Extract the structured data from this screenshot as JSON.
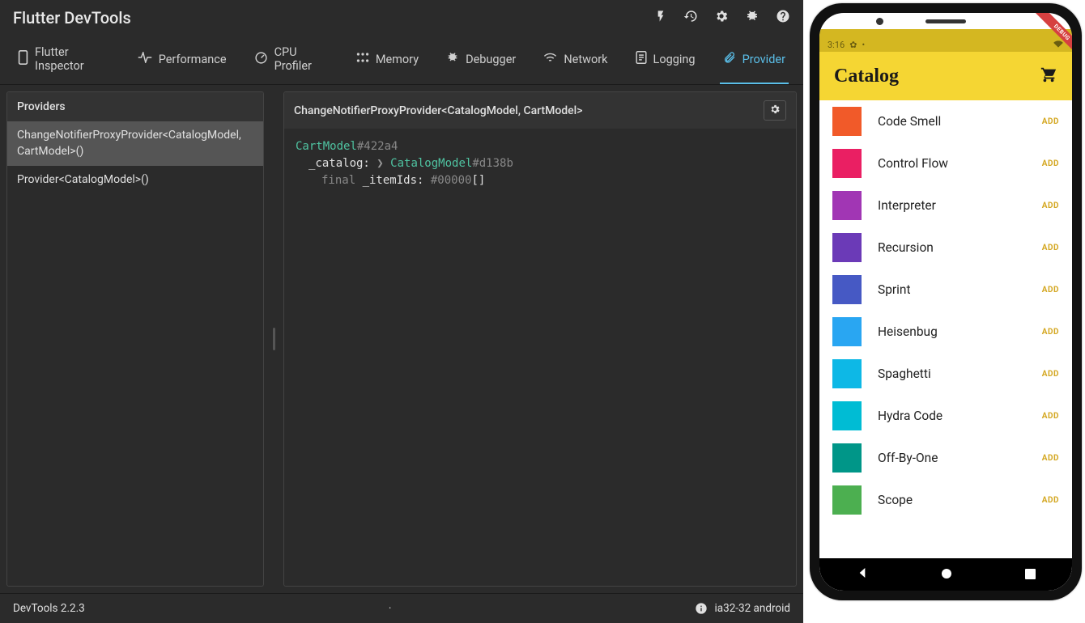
{
  "devtools": {
    "title": "Flutter DevTools",
    "tabs": [
      {
        "label": "Flutter Inspector",
        "icon": "phone"
      },
      {
        "label": "Performance",
        "icon": "pulse"
      },
      {
        "label": "CPU Profiler",
        "icon": "gauge"
      },
      {
        "label": "Memory",
        "icon": "dots"
      },
      {
        "label": "Debugger",
        "icon": "bug"
      },
      {
        "label": "Network",
        "icon": "wifi"
      },
      {
        "label": "Logging",
        "icon": "doc"
      },
      {
        "label": "Provider",
        "icon": "clip"
      }
    ],
    "active_tab": 7,
    "providers_panel": {
      "title": "Providers",
      "items": [
        "ChangeNotifierProxyProvider<CatalogModel, CartModel>()",
        "Provider<CatalogModel>()"
      ],
      "selected": 0
    },
    "detail_panel": {
      "title": "ChangeNotifierProxyProvider<CatalogModel, CartModel>",
      "root_type": "CartModel",
      "root_hash": "#422a4",
      "fields": [
        {
          "indent": 1,
          "name": "_catalog:",
          "arrow": true,
          "type": "CatalogModel",
          "hash": "#d138b"
        },
        {
          "indent": 2,
          "keyword": "final",
          "name": "_itemIds:",
          "type": "",
          "hash": "#00000",
          "suffix": "[]"
        }
      ]
    },
    "footer": {
      "version": "DevTools 2.2.3",
      "target": "ia32-32 android"
    }
  },
  "phone": {
    "status_time": "3:16",
    "debug_banner": "DEBUG",
    "app_title": "Catalog",
    "add_label": "ADD",
    "items": [
      {
        "name": "Code Smell",
        "color": "#f15a29"
      },
      {
        "name": "Control Flow",
        "color": "#ea1f63"
      },
      {
        "name": "Interpreter",
        "color": "#a136b4"
      },
      {
        "name": "Recursion",
        "color": "#6b3ab7"
      },
      {
        "name": "Sprint",
        "color": "#4659c4"
      },
      {
        "name": "Heisenbug",
        "color": "#29a6f2"
      },
      {
        "name": "Spaghetti",
        "color": "#0db8e6"
      },
      {
        "name": "Hydra Code",
        "color": "#00bcd4"
      },
      {
        "name": "Off-By-One",
        "color": "#009688"
      },
      {
        "name": "Scope",
        "color": "#4caf50"
      }
    ]
  }
}
